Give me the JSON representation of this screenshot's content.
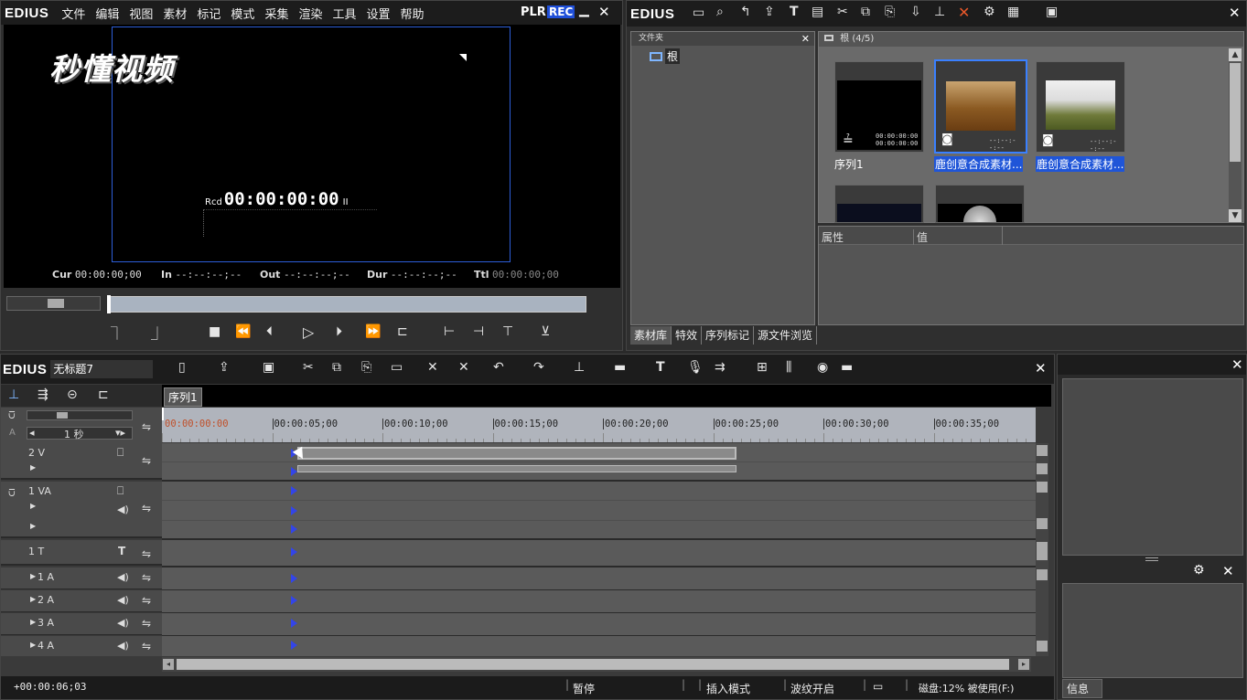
{
  "player": {
    "app_name": "EDIUS",
    "menu": [
      "文件",
      "编辑",
      "视图",
      "素材",
      "标记",
      "模式",
      "采集",
      "渲染",
      "工具",
      "设置",
      "帮助"
    ],
    "plr": "PLR",
    "rec": "REC",
    "logo_text": "秒懂视频",
    "rcd_label": "Rcd",
    "rcd_time": "00:00:00:00",
    "rcd_suffix": "II",
    "cur_label": "Cur",
    "cur_value": "00:00:00;00",
    "in_label": "In",
    "in_value": "--:--:--;--",
    "out_label": "Out",
    "out_value": "--:--:--;--",
    "dur_label": "Dur",
    "dur_value": "--:--:--;--",
    "ttl_label": "Ttl",
    "ttl_value": "00:00:00;00"
  },
  "bin": {
    "app_name": "EDIUS",
    "folder_header": "文件夹",
    "root_folder": "根",
    "path_label": "根 (4/5)",
    "clips": [
      {
        "name": "序列1",
        "tc1": "00:00:00:00",
        "tc2": "00:00:00:00",
        "selected": false
      },
      {
        "name": "鹿创意合成素材...",
        "tc1": "",
        "tc2": "--:--:--:--",
        "selected": true
      },
      {
        "name": "鹿创意合成素材...",
        "tc1": "",
        "tc2": "--:--:--:--",
        "selected": true
      }
    ],
    "prop_header": "属性",
    "value_header": "值",
    "tabs": [
      "素材库",
      "特效",
      "序列标记",
      "源文件浏览"
    ]
  },
  "timeline": {
    "app_name": "EDIUS",
    "project_name": "无标题7",
    "sequence_tab": "序列1",
    "scale_label": "1 秒",
    "ruler_labels": [
      "00:00:00:00",
      "00:00:05;00",
      "00:00:10;00",
      "00:00:15;00",
      "00:00:20;00",
      "00:00:25;00",
      "00:00:30;00",
      "00:00:35;00"
    ],
    "tracks": [
      {
        "name": "2 V"
      },
      {
        "name": "1 VA"
      },
      {
        "name": "1 T"
      },
      {
        "name": "1 A"
      },
      {
        "name": "2 A"
      },
      {
        "name": "3 A"
      },
      {
        "name": "4 A"
      }
    ]
  },
  "right_panel": {
    "info_tab": "信息"
  },
  "status": {
    "timecode": "+00:00:06;03",
    "state": "暂停",
    "mode": "插入模式",
    "ripple": "波纹开启",
    "disk": "磁盘:12% 被使用(F:)"
  }
}
